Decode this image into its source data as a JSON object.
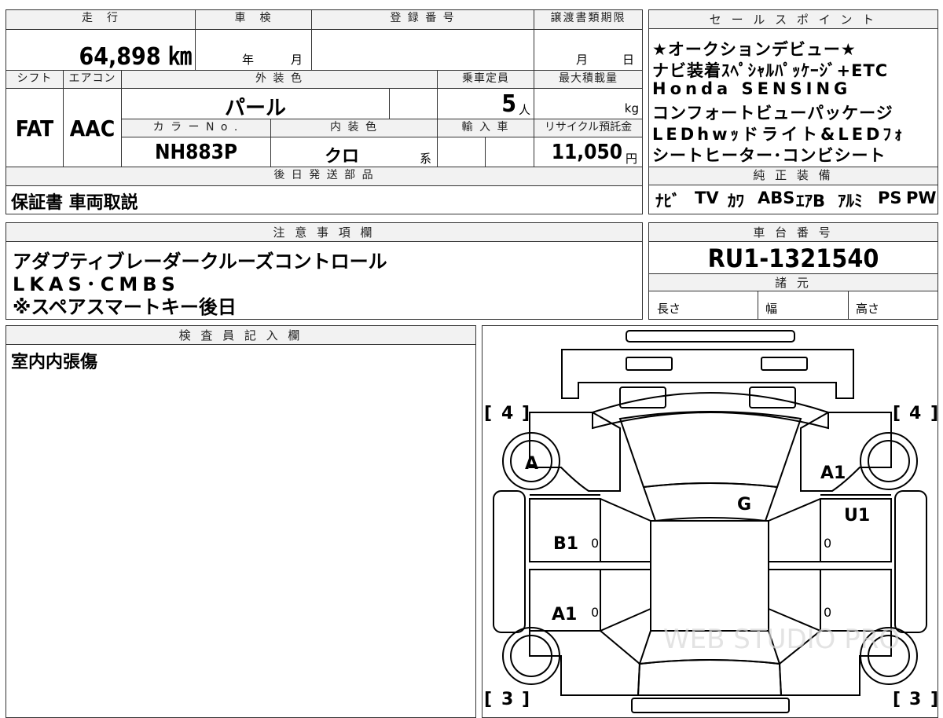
{
  "vehicle": {
    "headers": {
      "mileage": "走　行",
      "inspection": "車　検",
      "registration": "登 録 番 号",
      "transfer_deadline": "譲渡書類期限",
      "shift": "シフト",
      "aircon": "エアコン",
      "exterior_color": "外 装 色",
      "capacity": "乗車定員",
      "max_load": "最大積載量",
      "color_no": "カ ラ ー N o .",
      "interior_color": "内 装 色",
      "import": "輸 入 車",
      "recycle_fee": "リサイクル預託金",
      "sales_points": "セ ー ル ス ポ イ ン ト",
      "later_parts": "後 日 発 送 部 品",
      "standard_equipment": "純 正 装 備"
    },
    "mileage": "64,898 ㎞",
    "inspection_year_unit": "年",
    "inspection_month_unit": "月",
    "transfer_month_unit": "月",
    "transfer_day_unit": "日",
    "shift": "FAT",
    "aircon": "AAC",
    "exterior_color": "パール",
    "capacity": "5",
    "capacity_unit": "人",
    "max_load_unit": "kg",
    "color_no": "NH883P",
    "interior_color": "クロ",
    "interior_suffix": "系",
    "recycle_fee": "11,050",
    "recycle_unit": "円",
    "sales_points": [
      "★オークションデビュー★",
      "ナビ装着ｽﾍﾟｼｬﾙﾊﾟｯｹｰｼﾞ+ETC",
      "Honda SENSING",
      "コンフォートビューパッケージ",
      "LEDhwｯドライト&LEDﾌｫ",
      "シートヒーター･コンビシート"
    ],
    "later_parts": "保証書 車両取説",
    "equipment": [
      "ﾅﾋﾞ",
      "TV",
      "ｶﾜ",
      "ABS",
      "ｴｱB",
      "ｱﾙﾐ",
      "PS",
      "PW"
    ]
  },
  "notes": {
    "header": "注 意 事 項 欄",
    "lines": [
      "アダプティブレーダークルーズコントロール",
      "LKAS･CMBS",
      "※スペアスマートキー後日"
    ]
  },
  "chassis": {
    "header": "車 台 番 号",
    "number": "RU1-1321540",
    "spec_header": "諸 元",
    "length": "長さ",
    "width": "幅",
    "height": "高さ"
  },
  "inspector": {
    "header": "検 査 員 記 入 欄",
    "comment": "室内内張傷"
  },
  "diagram": {
    "tread_front_left": "4",
    "tread_front_right": "4",
    "tread_rear_left": "3",
    "tread_rear_right": "3",
    "mark_front_left_wheel": "A",
    "mark_front_right_fender": "A1",
    "mark_windshield": "G",
    "mark_right_front_door": "U1",
    "mark_left_front_door": "B1",
    "mark_left_rear_door": "A1",
    "door_zero": "0",
    "watermark": "WEB STUDIO PRO"
  }
}
